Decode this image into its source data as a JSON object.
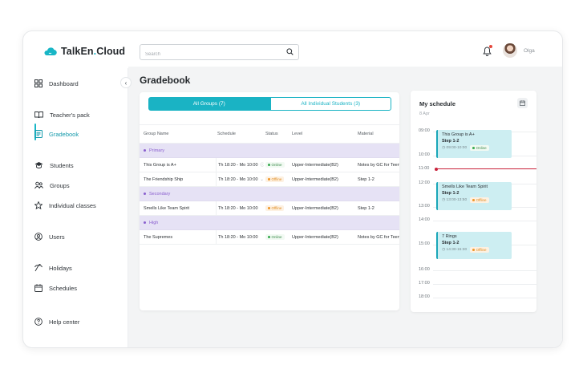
{
  "brand": {
    "name_part1": "TalkEn",
    "name_dot": ".",
    "name_part2": "Cloud"
  },
  "search": {
    "placeholder": "Search",
    "value": ""
  },
  "user": {
    "name": "Olga"
  },
  "sidebar": {
    "items": [
      {
        "label": "Dashboard",
        "icon": "dashboard-icon"
      },
      {
        "label": "Teacher's pack",
        "icon": "book-icon"
      },
      {
        "label": "Gradebook",
        "icon": "gradebook-icon",
        "active": true
      },
      {
        "label": "Students",
        "icon": "graduation-cap-icon"
      },
      {
        "label": "Groups",
        "icon": "groups-icon"
      },
      {
        "label": "Individual classes",
        "icon": "star-icon"
      },
      {
        "label": "Users",
        "icon": "user-circle-icon"
      },
      {
        "label": "Holidays",
        "icon": "holidays-icon"
      },
      {
        "label": "Schedules",
        "icon": "calendar-icon"
      },
      {
        "label": "Help center",
        "icon": "help-icon"
      }
    ]
  },
  "page": {
    "title": "Gradebook"
  },
  "tabs": [
    {
      "label": "All Groups (7)",
      "active": true
    },
    {
      "label": "All Individual Students (3)",
      "active": false
    }
  ],
  "table": {
    "headers": [
      "Group Name",
      "Schedule",
      "Status",
      "Level",
      "Material"
    ],
    "sections": [
      {
        "name": "Primary",
        "rows": [
          {
            "name": "This Group is A+",
            "schedule": "Th 18:20 - Mo 10:00",
            "status": "Online",
            "level": "Upper-Intermediate(B2)",
            "material": "Notes by GC for Teens"
          },
          {
            "name": "The Friendship Ship",
            "schedule": "Th 18:20 - Mo 10:00",
            "status": "Offline",
            "level": "Upper-Intermediate(B2)",
            "material": "Step 1-2"
          }
        ]
      },
      {
        "name": "Secondary",
        "rows": [
          {
            "name": "Smells Like Team Spirit",
            "schedule": "Th 18:20 - Mo 10:00",
            "status": "Offline",
            "level": "Upper-Intermediate(B2)",
            "material": "Step 1-2"
          }
        ]
      },
      {
        "name": "High",
        "rows": [
          {
            "name": "The Supremes",
            "schedule": "Th 18:20 - Mo 10:00",
            "status": "Online",
            "level": "Upper-Intermediate(B2)",
            "material": "Notes by GC for Teens"
          }
        ]
      }
    ]
  },
  "schedule": {
    "title": "My schedule",
    "date": "8 Apr",
    "times": [
      "09:00",
      "10:00",
      "11:00",
      "12:00",
      "13:00",
      "14:00",
      "15:00",
      "16:00",
      "17:00",
      "18:00"
    ],
    "events": [
      {
        "name": "This Group is A+",
        "step": "Step 1-2",
        "time": "09:00-10:00",
        "status": "Online"
      },
      {
        "name": "Smells Like Team Spirit",
        "step": "Step 1-2",
        "time": "13:00-13:50",
        "status": "Offline"
      },
      {
        "name": "7 Rings",
        "step": "Step 1-2",
        "time": "14:30-15:30",
        "status": "Offline"
      }
    ]
  },
  "colors": {
    "accent": "#1ab3c4",
    "category_bg": "#e6e2f5",
    "online": "#3fae56",
    "offline": "#f09a2e",
    "now_line": "#c8213a"
  }
}
